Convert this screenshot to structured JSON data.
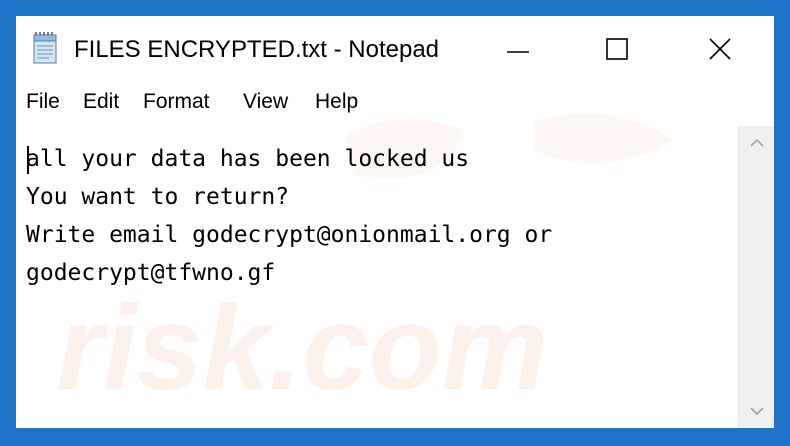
{
  "window": {
    "title": "FILES ENCRYPTED.txt - Notepad",
    "app_icon": "notepad-icon",
    "controls": {
      "minimize_icon": "minimize-icon",
      "maximize_icon": "maximize-icon",
      "close_icon": "close-icon"
    }
  },
  "menu": {
    "items": [
      {
        "label": "File"
      },
      {
        "label": "Edit"
      },
      {
        "label": "Format"
      },
      {
        "label": "View"
      },
      {
        "label": "Help"
      }
    ]
  },
  "document": {
    "lines": [
      "all your data has been locked us",
      "You want to return?",
      "Write email godecrypt@onionmail.org or",
      "godecrypt@tfwno.gf"
    ]
  },
  "watermark": {
    "text": "risk.com"
  },
  "colors": {
    "frame": "#1d74c9",
    "background": "#ffffff",
    "scrollbar": "#f0f0f0"
  }
}
